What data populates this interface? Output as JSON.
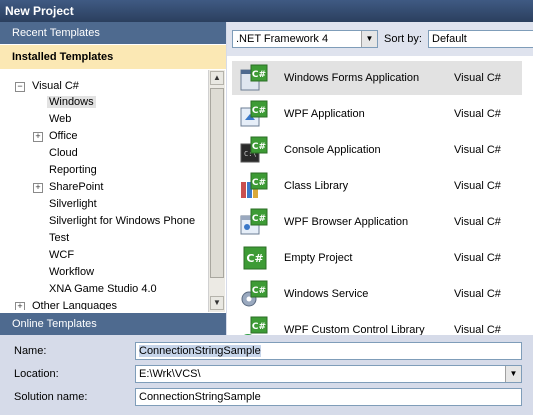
{
  "window": {
    "title": "New Project"
  },
  "left": {
    "recent_templates": "Recent Templates",
    "installed_templates": "Installed Templates",
    "online_templates": "Online Templates",
    "tree": [
      {
        "label": "Visual C#",
        "expander": "−"
      },
      {
        "label": "Windows",
        "selected": true
      },
      {
        "label": "Web"
      },
      {
        "label": "Office",
        "expander": "+"
      },
      {
        "label": "Cloud"
      },
      {
        "label": "Reporting"
      },
      {
        "label": "SharePoint",
        "expander": "+"
      },
      {
        "label": "Silverlight"
      },
      {
        "label": "Silverlight for Windows Phone"
      },
      {
        "label": "Test"
      },
      {
        "label": "WCF"
      },
      {
        "label": "Workflow"
      },
      {
        "label": "XNA Game Studio 4.0"
      },
      {
        "label": "Other Languages",
        "expander": "+"
      }
    ]
  },
  "toolbar": {
    "framework": ".NET Framework 4",
    "sort_label": "Sort by:",
    "sort_value": "Default"
  },
  "templates": [
    {
      "name": "Windows Forms Application",
      "lang": "Visual C#",
      "selected": true
    },
    {
      "name": "WPF Application",
      "lang": "Visual C#"
    },
    {
      "name": "Console Application",
      "lang": "Visual C#"
    },
    {
      "name": "Class Library",
      "lang": "Visual C#"
    },
    {
      "name": "WPF Browser Application",
      "lang": "Visual C#"
    },
    {
      "name": "Empty Project",
      "lang": "Visual C#"
    },
    {
      "name": "Windows Service",
      "lang": "Visual C#"
    },
    {
      "name": "WPF Custom Control Library",
      "lang": "Visual C#"
    }
  ],
  "form": {
    "name_label": "Name:",
    "name_value": "ConnectionStringSample",
    "location_label": "Location:",
    "location_value": "E:\\Wrk\\VCS\\",
    "solution_label": "Solution name:",
    "solution_value": "ConnectionStringSample"
  },
  "colors": {
    "accent": "#4e6a8f",
    "highlight": "#fbe8b4",
    "csharp_green": "#3d9b35"
  }
}
